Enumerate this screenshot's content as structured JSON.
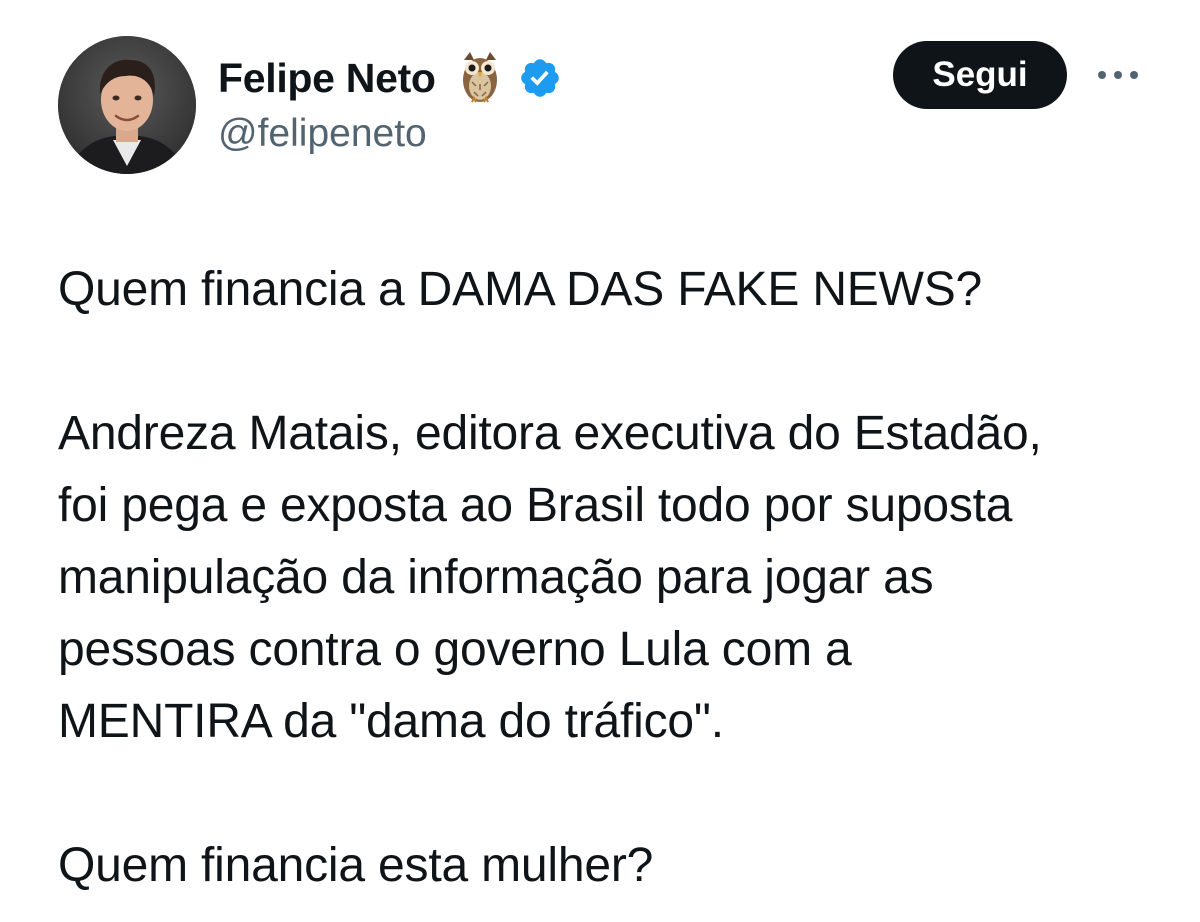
{
  "author": {
    "display_name": "Felipe Neto",
    "emoji": "🦉",
    "handle": "@felipeneto",
    "verified": true,
    "verified_color": "#1d9bf0"
  },
  "actions": {
    "follow_label": "Segui",
    "more_icon": "ellipsis-icon"
  },
  "tweet": {
    "paragraphs": [
      [
        "Quem financia a DAMA DAS FAKE NEWS?"
      ],
      [
        "Andreza Matais, editora executiva do Estadão,",
        "foi pega e exposta ao Brasil todo por suposta",
        "manipulação da informação para jogar as",
        "pessoas contra o governo Lula com a",
        "MENTIRA da \"dama do tráfico\"."
      ],
      [
        "Quem financia esta mulher?"
      ]
    ]
  },
  "colors": {
    "text_primary": "#0f1419",
    "text_secondary": "#536471",
    "button_bg": "#0f1419",
    "button_text": "#ffffff"
  }
}
